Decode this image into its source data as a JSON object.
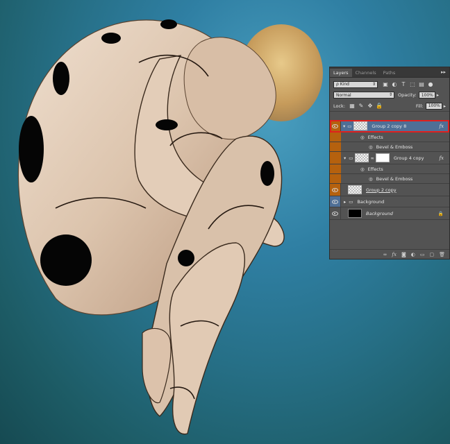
{
  "panel": {
    "tabs": [
      {
        "label": "Layers"
      },
      {
        "label": "Channels"
      },
      {
        "label": "Paths"
      }
    ],
    "collapse_label": "▸▸",
    "filter_label": "ρ Kind",
    "blend_mode": "Normal",
    "opacity_label": "Opacity:",
    "opacity_value": "100%",
    "lock_label": "Lock:",
    "fill_label": "Fill:",
    "fill_value": "100%",
    "layers": [
      {
        "name": "Group 2 copy 8",
        "fx": "fx",
        "selected": true
      },
      {
        "name": "Effects"
      },
      {
        "name": "Bevel & Emboss"
      },
      {
        "name": "Group 4 copy",
        "fx": "fx"
      },
      {
        "name": "Effects"
      },
      {
        "name": "Bevel & Emboss"
      },
      {
        "name": "Group 2 copy"
      },
      {
        "name": "Background"
      },
      {
        "name": "Background"
      }
    ]
  },
  "colors": {
    "selection_outline": "#e0201e",
    "group_color_label": "#b5610e",
    "folder_highlight": "#4f6f96"
  }
}
